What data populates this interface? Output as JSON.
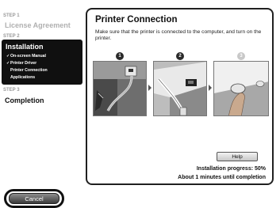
{
  "sidebar": {
    "step1_label": "STEP 1",
    "step1_title": "License Agreement",
    "step2_label": "STEP 2",
    "step2_title": "Installation",
    "step2_items": [
      {
        "label": "On-screen Manual",
        "done": true
      },
      {
        "label": "Printer Driver",
        "done": true
      },
      {
        "label": "Printer Connection",
        "done": false
      },
      {
        "label": "Applications",
        "done": false
      }
    ],
    "step3_label": "STEP 3",
    "step3_title": "Completion"
  },
  "main": {
    "heading": "Printer Connection",
    "description": "Make sure that the printer is connected to the computer, and turn on the printer.",
    "step_numbers": [
      "1",
      "2",
      "3"
    ],
    "help_label": "Help",
    "progress_text": "Installation progress: 50%",
    "time_text": "About 1 minutes until completion"
  },
  "footer": {
    "cancel_label": "Cancel"
  },
  "colors": {
    "active_bg": "#101010",
    "inactive_text": "#b5b5b5"
  }
}
